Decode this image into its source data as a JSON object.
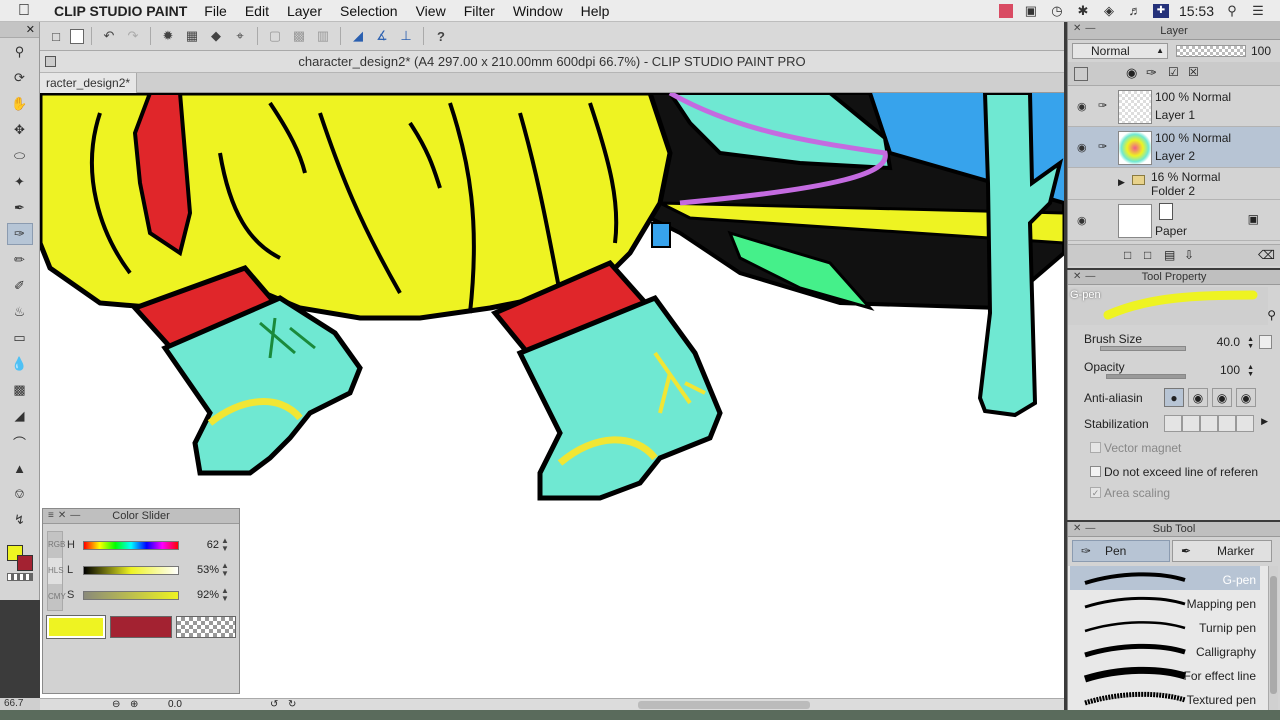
{
  "menubar": {
    "app_name": "CLIP STUDIO PAINT",
    "items": [
      "File",
      "Edit",
      "Layer",
      "Selection",
      "View",
      "Filter",
      "Window",
      "Help"
    ],
    "clock": "15:53"
  },
  "canvas": {
    "title": "character_design2* (A4 297.00 x 210.00mm 600dpi 66.7%)  - CLIP STUDIO PAINT PRO",
    "tab_label": "racter_design2*"
  },
  "status": {
    "zoom": "66.7",
    "rotation": "0.0"
  },
  "color_slider": {
    "title": "Color Slider",
    "side_tabs": [
      "RGB",
      "HLS",
      "CMY"
    ],
    "h_label": "H",
    "h_value": "62",
    "l_label": "L",
    "l_value": "53",
    "s_label": "S",
    "s_value": "92",
    "pct": "%",
    "main_color": "#eef322",
    "sub_color": "#a32231"
  },
  "layer_panel": {
    "title": "Layer",
    "blend_mode": "Normal",
    "opacity": "100",
    "layers": [
      {
        "line1": "100 % Normal",
        "line2": "Layer 1"
      },
      {
        "line1": "100 % Normal",
        "line2": "Layer 2"
      },
      {
        "line1": "16 % Normal",
        "line2": "Folder 2"
      },
      {
        "line1": "",
        "line2": "Paper"
      }
    ]
  },
  "tool_property": {
    "title": "Tool Property",
    "brush_name": "G-pen",
    "brush_size_label": "Brush Size",
    "brush_size_value": "40.0",
    "opacity_label": "Opacity",
    "opacity_value": "100",
    "anti_alias_label": "Anti-aliasin",
    "stabilization_label": "Stabilization",
    "vector_magnet_label": "Vector magnet",
    "no_exceed_label": "Do not exceed line of referen",
    "area_scaling_label": "Area scaling"
  },
  "sub_tool": {
    "title": "Sub Tool",
    "tab_pen": "Pen",
    "tab_marker": "Marker",
    "brushes": [
      "G-pen",
      "Mapping pen",
      "Turnip pen",
      "Calligraphy",
      "For effect line",
      "Textured pen"
    ]
  }
}
